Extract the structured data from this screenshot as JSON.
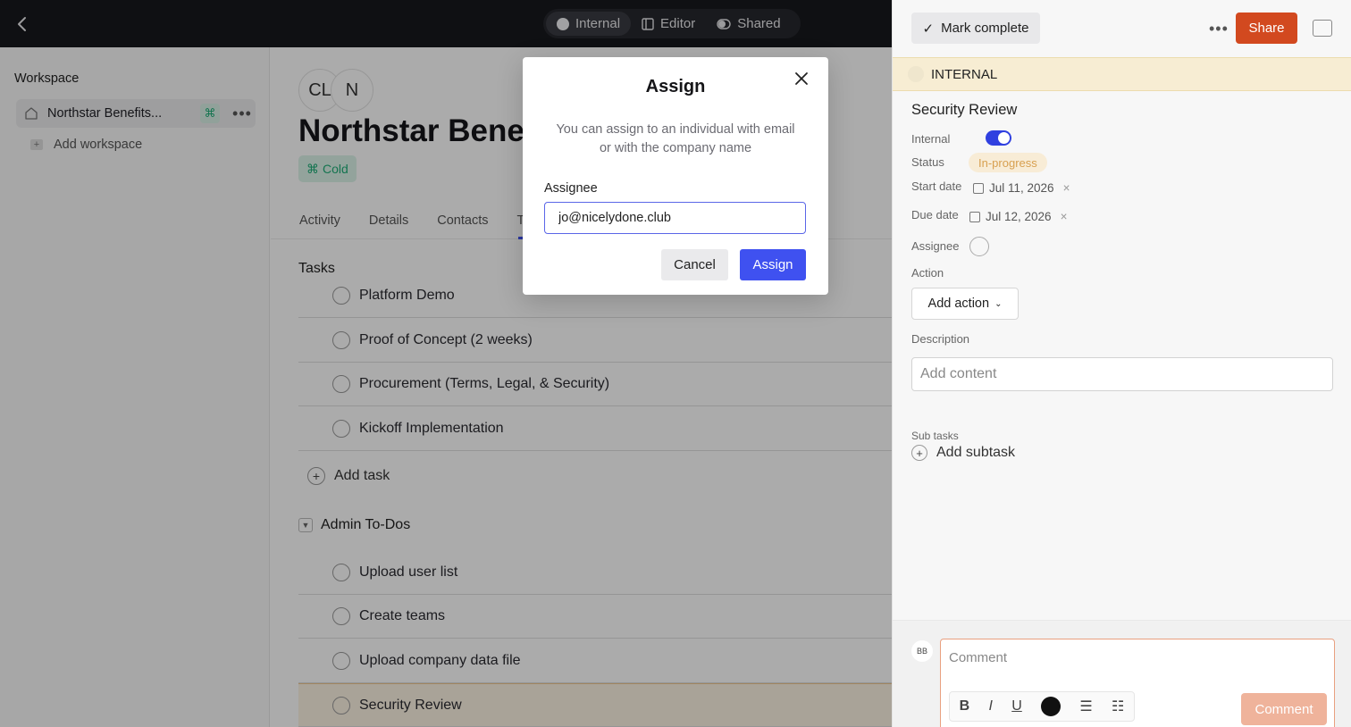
{
  "topbar": {
    "modes": [
      {
        "label": "Internal",
        "icon": "circle-icon",
        "active": true
      },
      {
        "label": "Editor",
        "icon": "editor-icon",
        "active": false
      },
      {
        "label": "Shared",
        "icon": "shared-icon",
        "active": false
      }
    ]
  },
  "sidebar": {
    "title": "Workspace",
    "workspace_name": "Northstar Benefits...",
    "add_workspace": "Add workspace"
  },
  "main": {
    "avatars": [
      "CL",
      "N"
    ],
    "title": "Northstar Benefi",
    "tag": "Cold",
    "tabs": [
      "Activity",
      "Details",
      "Contacts",
      "T"
    ],
    "tasks_title": "Tasks",
    "tasks": [
      "Platform Demo",
      "Proof of Concept (2 weeks)",
      "Procurement (Terms, Legal, & Security)",
      "Kickoff Implementation"
    ],
    "add_task": "Add task",
    "group_title": "Admin To-Dos",
    "admin_tasks": [
      "Upload user list",
      "Create teams",
      "Upload company data file",
      "Security Review"
    ]
  },
  "panel": {
    "mark_complete": "Mark complete",
    "share": "Share",
    "visibility": "INTERNAL",
    "task_title": "Security Review",
    "labels": {
      "internal": "Internal",
      "status": "Status",
      "start_date": "Start date",
      "due_date": "Due date",
      "assignee": "Assignee",
      "action": "Action",
      "description": "Description",
      "sub_tasks": "Sub tasks"
    },
    "status": "In-progress",
    "internal_toggle_on": true,
    "start_date": "Jul 11, 2026",
    "due_date": "Jul 12, 2026",
    "add_action": "Add action",
    "description_placeholder": "Add content",
    "add_subtask": "Add subtask",
    "commenter_initials": "BB",
    "comment_placeholder": "Comment",
    "comment_button": "Comment",
    "accent_color": "#d2491f"
  },
  "modal": {
    "title": "Assign",
    "description": "You can assign to an individual with email or with the company name",
    "field_label": "Assignee",
    "input_value": "jo@nicelydone.club",
    "cancel": "Cancel",
    "assign": "Assign",
    "primary_color": "#3f51f0"
  }
}
